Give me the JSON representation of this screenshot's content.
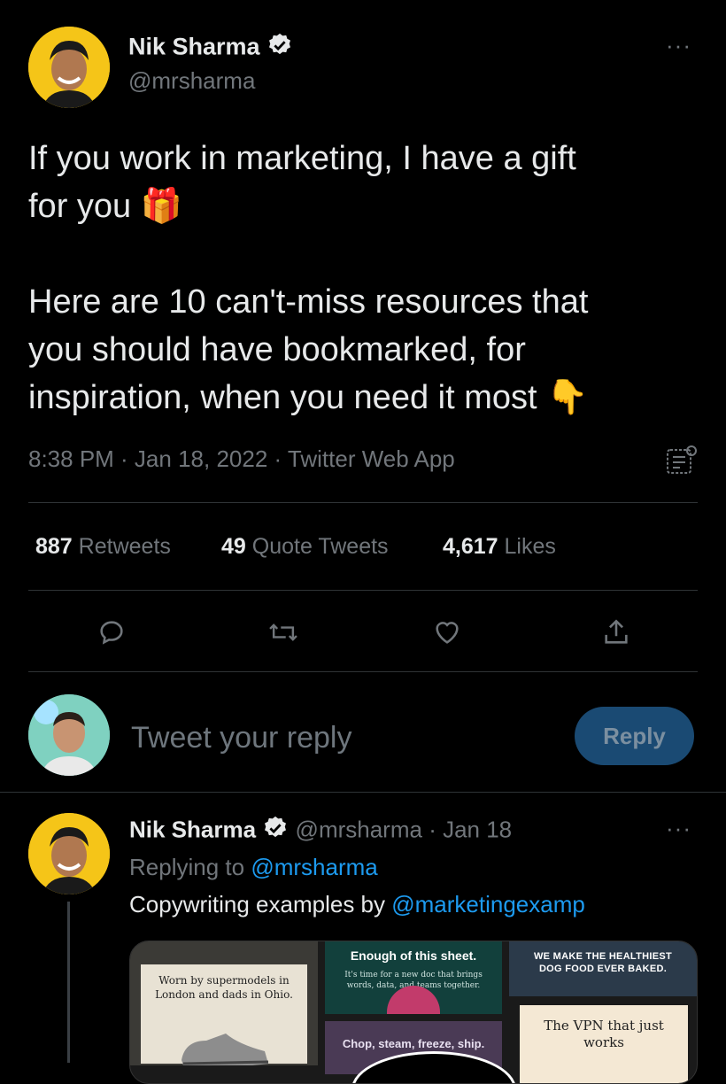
{
  "tweet": {
    "author_name": "Nik Sharma",
    "author_handle": "@mrsharma",
    "text_line1": "If you work in marketing, I have a gift",
    "text_line2": "for you",
    "gift_emoji": "🎁",
    "text_line3": "Here are 10 can't-miss resources that",
    "text_line4": "you should have bookmarked, for",
    "text_line5": "inspiration, when you need it most",
    "point_emoji": "👇",
    "timestamp": "8:38 PM · Jan 18, 2022 · Twitter Web App",
    "more_label": "···"
  },
  "stats": {
    "retweets_count": "887",
    "retweets_label": "Retweets",
    "quotes_count": "49",
    "quotes_label": "Quote Tweets",
    "likes_count": "4,617",
    "likes_label": "Likes"
  },
  "compose": {
    "placeholder": "Tweet your reply",
    "reply_button": "Reply"
  },
  "reply": {
    "author_name": "Nik Sharma",
    "author_handle": "@mrsharma",
    "date": "· Jan 18",
    "replying_prefix": "Replying to ",
    "replying_handle": "@mrsharma",
    "text_prefix": "Copywriting examples by ",
    "text_mention": "@marketingexamp",
    "more_label": "···",
    "media": {
      "tile1_text": "Worn by supermodels in London and dads in Ohio.",
      "tile2_title": "Enough of this sheet.",
      "tile2_sub": "It's time for a new doc that brings words, data, and teams together.",
      "tile3_text": "WE MAKE THE HEALTHIEST DOG FOOD EVER BAKED.",
      "tile4_text": "Chop, steam, freeze, ship.",
      "tile5_text": "The VPN that just works"
    }
  },
  "colors": {
    "background": "#000000",
    "text": "#e7e9ea",
    "muted": "#71767b",
    "link": "#1d9bf0",
    "divider": "#2f3336",
    "reply_button_bg": "#1a4a73"
  }
}
